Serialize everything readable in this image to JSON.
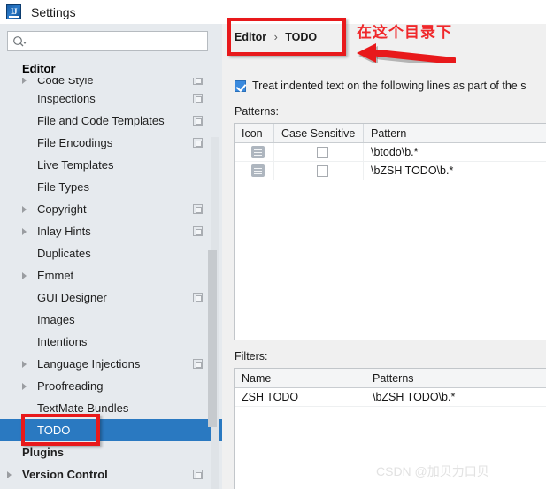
{
  "window": {
    "title": "Settings",
    "app_icon": "intellij-idea-logo-icon"
  },
  "sidebar": {
    "search": {
      "value": "",
      "placeholder": "",
      "icon": "search-icon",
      "dropdown_icon": "chevron-down-icon"
    },
    "group_header": "Editor",
    "clipped_item": "Code Style",
    "items": [
      {
        "label": "Inspections",
        "indent": 2,
        "expandable": false,
        "badge": true,
        "selected": false
      },
      {
        "label": "File and Code Templates",
        "indent": 2,
        "expandable": false,
        "badge": true,
        "selected": false
      },
      {
        "label": "File Encodings",
        "indent": 2,
        "expandable": false,
        "badge": true,
        "selected": false
      },
      {
        "label": "Live Templates",
        "indent": 2,
        "expandable": false,
        "badge": false,
        "selected": false
      },
      {
        "label": "File Types",
        "indent": 2,
        "expandable": false,
        "badge": false,
        "selected": false
      },
      {
        "label": "Copyright",
        "indent": 2,
        "expandable": true,
        "badge": true,
        "selected": false
      },
      {
        "label": "Inlay Hints",
        "indent": 2,
        "expandable": true,
        "badge": true,
        "selected": false
      },
      {
        "label": "Duplicates",
        "indent": 2,
        "expandable": false,
        "badge": false,
        "selected": false
      },
      {
        "label": "Emmet",
        "indent": 2,
        "expandable": true,
        "badge": false,
        "selected": false
      },
      {
        "label": "GUI Designer",
        "indent": 2,
        "expandable": false,
        "badge": true,
        "selected": false
      },
      {
        "label": "Images",
        "indent": 2,
        "expandable": false,
        "badge": false,
        "selected": false
      },
      {
        "label": "Intentions",
        "indent": 2,
        "expandable": false,
        "badge": false,
        "selected": false
      },
      {
        "label": "Language Injections",
        "indent": 2,
        "expandable": true,
        "badge": true,
        "selected": false
      },
      {
        "label": "Proofreading",
        "indent": 2,
        "expandable": true,
        "badge": false,
        "selected": false
      },
      {
        "label": "TextMate Bundles",
        "indent": 2,
        "expandable": false,
        "badge": false,
        "selected": false
      },
      {
        "label": "TODO",
        "indent": 2,
        "expandable": false,
        "badge": false,
        "selected": true
      },
      {
        "label": "Plugins",
        "indent": 1,
        "expandable": false,
        "badge": false,
        "selected": false
      },
      {
        "label": "Version Control",
        "indent": 1,
        "expandable": true,
        "badge": true,
        "selected": false
      }
    ],
    "selection_color": "#2a79c1",
    "background_color": "#e6eaee"
  },
  "content": {
    "breadcrumb": {
      "root": "Editor",
      "separator": "›",
      "leaf": "TODO"
    },
    "checkbox": {
      "checked": true,
      "label": "Treat indented text on the following lines as part of the s"
    },
    "patterns": {
      "label": "Patterns:",
      "columns": [
        "Icon",
        "Case Sensitive",
        "Pattern"
      ],
      "rows": [
        {
          "icon": "list-icon",
          "case_sensitive": false,
          "pattern": "\\btodo\\b.*"
        },
        {
          "icon": "list-icon",
          "case_sensitive": false,
          "pattern": "\\bZSH TODO\\b.*"
        }
      ]
    },
    "filters": {
      "label": "Filters:",
      "columns": [
        "Name",
        "Patterns"
      ],
      "rows": [
        {
          "name": "ZSH TODO",
          "patterns": "\\bZSH TODO\\b.*"
        }
      ]
    }
  },
  "annotations": {
    "color": "#e8191b",
    "note_text": "在这个目录下",
    "arrow": "left-pointing-arrow",
    "highlight_breadcrumb": true,
    "highlight_todo_item": true
  },
  "watermark": "CSDN @加贝力口贝"
}
